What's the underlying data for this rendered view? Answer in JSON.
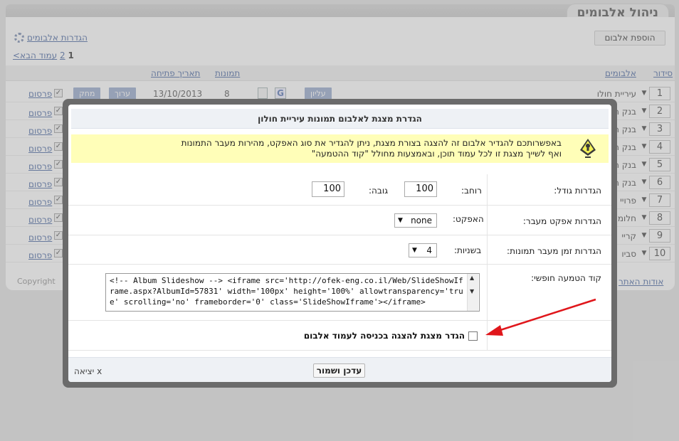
{
  "header": {
    "title": "ניהול אלבומים"
  },
  "toolbar": {
    "add_album": "הוספת אלבום",
    "album_settings": "הגדרות אלבומים",
    "next_page": "עמוד הבא>",
    "current_page": "1",
    "page_2": "2"
  },
  "table": {
    "headers": {
      "order": "סידור",
      "albums": "אלבומים",
      "images": "תמונות",
      "opened": "תאריך פתיחה"
    },
    "rows": [
      {
        "order": "1",
        "name": "עיריית חולון",
        "count": "8",
        "date": "13/10/2013",
        "publish": "פרסום",
        "checked": true,
        "edit": "ערוך",
        "delete": "מחק",
        "top": "עליון"
      },
      {
        "order": "2",
        "name": "בנק ה",
        "publish": "פרסום",
        "checked": true
      },
      {
        "order": "3",
        "name": "בנק ה",
        "publish": "פרסום",
        "checked": true
      },
      {
        "order": "4",
        "name": "בנק ה",
        "publish": "פרסום",
        "checked": true
      },
      {
        "order": "5",
        "name": "בנק ה",
        "publish": "פרסום",
        "checked": true
      },
      {
        "order": "6",
        "name": "בנק ה",
        "publish": "פרסום",
        "checked": true
      },
      {
        "order": "7",
        "name": "פרויי",
        "publish": "פרסום",
        "checked": true
      },
      {
        "order": "8",
        "name": "חלומ",
        "publish": "פרסום",
        "checked": true
      },
      {
        "order": "9",
        "name": "קריי",
        "publish": "פרסום",
        "checked": true
      },
      {
        "order": "10",
        "name": "סביו",
        "publish": "פרסום",
        "checked": true
      }
    ]
  },
  "footer": {
    "copyright": "Copyright",
    "about": "אודות האתר"
  },
  "modal": {
    "title": "הגדרת מצגת לאלבום תמונות עיריית חולון",
    "info_line1": "באפשרותכם להגדיר אלבום זה להצגה בצורת מצגת, ניתן להגדיר את סוג האפקט, מהירות מעבר התמונות",
    "info_line2": "ואף לשייך מצגת זו לכל עמוד תוכן, ובאמצעות מחולל \"קוד ההטמעה\"",
    "size_label": "הגדרות גודל:",
    "width_label": "רוחב:",
    "width_value": "100",
    "height_label": "גובה:",
    "height_value": "100",
    "effect_section_label": "הגדרות אפקט מעבר:",
    "effect_label": "האפקט:",
    "effect_value": "none",
    "time_section_label": "הגדרות זמן מעבר תמונות:",
    "seconds_label": "בשניות:",
    "seconds_value": "4",
    "embed_label": "קוד הטמעה חופשי:",
    "embed_code": "<!-- Album Slideshow --> <iframe src='http://ofek-eng.co.il/Web/SlideShowIframe.aspx?AlbumId=57831' width='100px' height='100%' allowtransparency='true' scrolling='no' frameborder='0' class='SlideShowIframe'></iframe>",
    "checkbox_label": "הגדר מצגת להצגה בכניסה לעמוד אלבום",
    "save_button": "עדכן ושמור",
    "exit": "x יציאה"
  },
  "colors": {
    "accent": "#8fa3c8",
    "info_bg": "#fffeb8",
    "modal_frame": "#6b6b6b",
    "annotation_arrow": "#e0161b"
  },
  "icons": [
    "settings-gear-icon",
    "warning-lightbulb-icon",
    "google-icon",
    "document-icon",
    "dropdown-arrow-icon"
  ]
}
